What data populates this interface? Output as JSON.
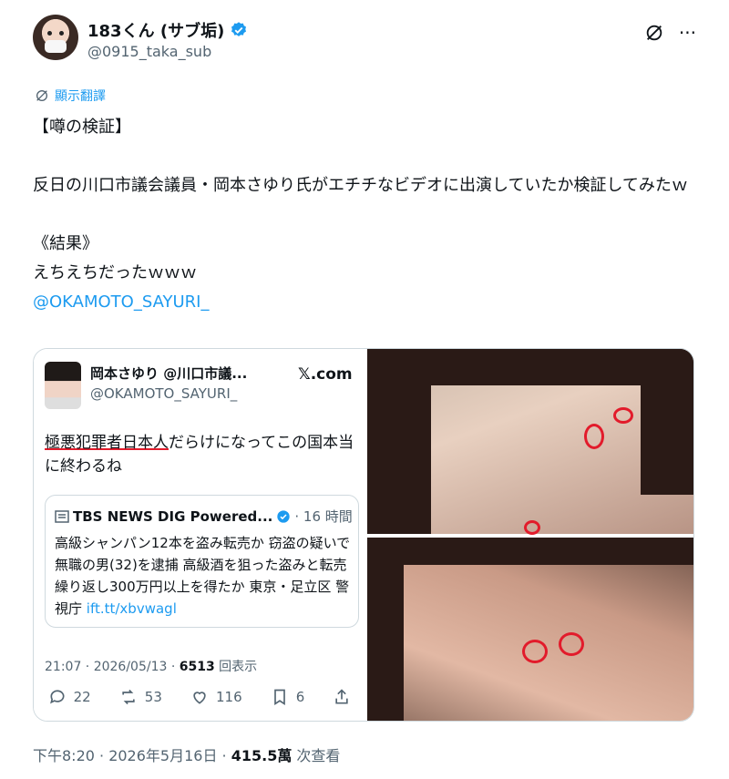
{
  "author": {
    "display_name": "183くん (サブ垢)",
    "handle": "@0915_taka_sub"
  },
  "translate_label": "顯示翻譯",
  "tweet": {
    "line1": "【噂の検証】",
    "line2": "反日の川口市議会議員・岡本さゆり氏がエチチなビデオに出演していたか検証してみたｗ",
    "line3": "《結果》",
    "line4": "えちえちだったｗｗｗ",
    "mention": "@OKAMOTO_SAYURI_"
  },
  "quote": {
    "name": "岡本さゆり @川口市議...",
    "handle": "@OKAMOTO_SAYURI_",
    "source": "𝕏.com",
    "text_underlined": "極悪犯罪者日本人",
    "text_rest": "だらけになってこの国本当に終わるね",
    "nested": {
      "name": "TBS NEWS DIG Powered...",
      "time": "· 16 時間",
      "text": "高級シャンパン12本を盗み転売か 窃盗の疑いで無職の男(32)を逮捕 高級酒を狙った盗みと転売繰り返し300万円以上を得たか 東京・足立区 警視庁 ",
      "link": "ift.tt/xbvwagl"
    },
    "meta_time": "21:07 · 2026/05/13 · ",
    "meta_views": "6513",
    "meta_views_label": " 回表示",
    "actions": {
      "replies": "22",
      "reposts": "53",
      "likes": "116",
      "bookmarks": "6"
    }
  },
  "footer": {
    "time": "下午8:20 · 2026年5月16日 · ",
    "views": "415.5萬",
    "views_label": " 次查看"
  },
  "colors": {
    "accent": "#1d9bf0",
    "secondary_text": "#536471",
    "circle_red": "#e21b2b"
  }
}
